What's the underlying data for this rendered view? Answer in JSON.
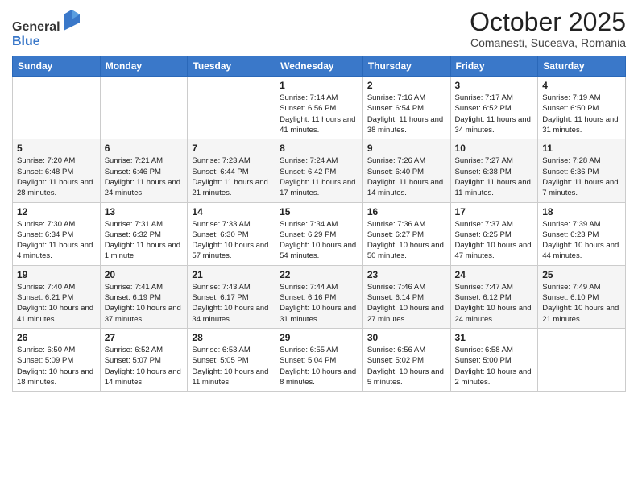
{
  "header": {
    "logo": {
      "general": "General",
      "blue": "Blue"
    },
    "title": "October 2025",
    "subtitle": "Comanesti, Suceava, Romania"
  },
  "days_of_week": [
    "Sunday",
    "Monday",
    "Tuesday",
    "Wednesday",
    "Thursday",
    "Friday",
    "Saturday"
  ],
  "weeks": [
    [
      {
        "day": "",
        "info": ""
      },
      {
        "day": "",
        "info": ""
      },
      {
        "day": "",
        "info": ""
      },
      {
        "day": "1",
        "info": "Sunrise: 7:14 AM\nSunset: 6:56 PM\nDaylight: 11 hours and 41 minutes."
      },
      {
        "day": "2",
        "info": "Sunrise: 7:16 AM\nSunset: 6:54 PM\nDaylight: 11 hours and 38 minutes."
      },
      {
        "day": "3",
        "info": "Sunrise: 7:17 AM\nSunset: 6:52 PM\nDaylight: 11 hours and 34 minutes."
      },
      {
        "day": "4",
        "info": "Sunrise: 7:19 AM\nSunset: 6:50 PM\nDaylight: 11 hours and 31 minutes."
      }
    ],
    [
      {
        "day": "5",
        "info": "Sunrise: 7:20 AM\nSunset: 6:48 PM\nDaylight: 11 hours and 28 minutes."
      },
      {
        "day": "6",
        "info": "Sunrise: 7:21 AM\nSunset: 6:46 PM\nDaylight: 11 hours and 24 minutes."
      },
      {
        "day": "7",
        "info": "Sunrise: 7:23 AM\nSunset: 6:44 PM\nDaylight: 11 hours and 21 minutes."
      },
      {
        "day": "8",
        "info": "Sunrise: 7:24 AM\nSunset: 6:42 PM\nDaylight: 11 hours and 17 minutes."
      },
      {
        "day": "9",
        "info": "Sunrise: 7:26 AM\nSunset: 6:40 PM\nDaylight: 11 hours and 14 minutes."
      },
      {
        "day": "10",
        "info": "Sunrise: 7:27 AM\nSunset: 6:38 PM\nDaylight: 11 hours and 11 minutes."
      },
      {
        "day": "11",
        "info": "Sunrise: 7:28 AM\nSunset: 6:36 PM\nDaylight: 11 hours and 7 minutes."
      }
    ],
    [
      {
        "day": "12",
        "info": "Sunrise: 7:30 AM\nSunset: 6:34 PM\nDaylight: 11 hours and 4 minutes."
      },
      {
        "day": "13",
        "info": "Sunrise: 7:31 AM\nSunset: 6:32 PM\nDaylight: 11 hours and 1 minute."
      },
      {
        "day": "14",
        "info": "Sunrise: 7:33 AM\nSunset: 6:30 PM\nDaylight: 10 hours and 57 minutes."
      },
      {
        "day": "15",
        "info": "Sunrise: 7:34 AM\nSunset: 6:29 PM\nDaylight: 10 hours and 54 minutes."
      },
      {
        "day": "16",
        "info": "Sunrise: 7:36 AM\nSunset: 6:27 PM\nDaylight: 10 hours and 50 minutes."
      },
      {
        "day": "17",
        "info": "Sunrise: 7:37 AM\nSunset: 6:25 PM\nDaylight: 10 hours and 47 minutes."
      },
      {
        "day": "18",
        "info": "Sunrise: 7:39 AM\nSunset: 6:23 PM\nDaylight: 10 hours and 44 minutes."
      }
    ],
    [
      {
        "day": "19",
        "info": "Sunrise: 7:40 AM\nSunset: 6:21 PM\nDaylight: 10 hours and 41 minutes."
      },
      {
        "day": "20",
        "info": "Sunrise: 7:41 AM\nSunset: 6:19 PM\nDaylight: 10 hours and 37 minutes."
      },
      {
        "day": "21",
        "info": "Sunrise: 7:43 AM\nSunset: 6:17 PM\nDaylight: 10 hours and 34 minutes."
      },
      {
        "day": "22",
        "info": "Sunrise: 7:44 AM\nSunset: 6:16 PM\nDaylight: 10 hours and 31 minutes."
      },
      {
        "day": "23",
        "info": "Sunrise: 7:46 AM\nSunset: 6:14 PM\nDaylight: 10 hours and 27 minutes."
      },
      {
        "day": "24",
        "info": "Sunrise: 7:47 AM\nSunset: 6:12 PM\nDaylight: 10 hours and 24 minutes."
      },
      {
        "day": "25",
        "info": "Sunrise: 7:49 AM\nSunset: 6:10 PM\nDaylight: 10 hours and 21 minutes."
      }
    ],
    [
      {
        "day": "26",
        "info": "Sunrise: 6:50 AM\nSunset: 5:09 PM\nDaylight: 10 hours and 18 minutes."
      },
      {
        "day": "27",
        "info": "Sunrise: 6:52 AM\nSunset: 5:07 PM\nDaylight: 10 hours and 14 minutes."
      },
      {
        "day": "28",
        "info": "Sunrise: 6:53 AM\nSunset: 5:05 PM\nDaylight: 10 hours and 11 minutes."
      },
      {
        "day": "29",
        "info": "Sunrise: 6:55 AM\nSunset: 5:04 PM\nDaylight: 10 hours and 8 minutes."
      },
      {
        "day": "30",
        "info": "Sunrise: 6:56 AM\nSunset: 5:02 PM\nDaylight: 10 hours and 5 minutes."
      },
      {
        "day": "31",
        "info": "Sunrise: 6:58 AM\nSunset: 5:00 PM\nDaylight: 10 hours and 2 minutes."
      },
      {
        "day": "",
        "info": ""
      }
    ]
  ],
  "colors": {
    "header_bg": "#3a78c9",
    "header_text": "#ffffff",
    "border": "#bbbbbb",
    "row_even": "#f5f5f5",
    "row_odd": "#ffffff"
  }
}
